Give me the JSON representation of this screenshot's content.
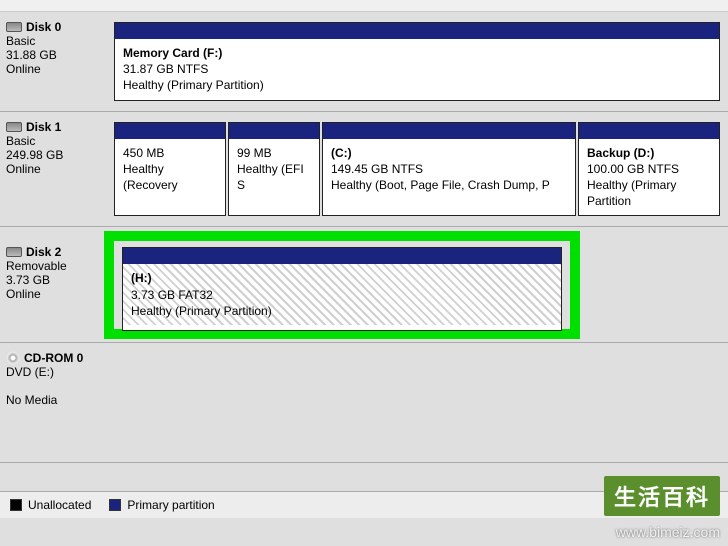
{
  "disks": [
    {
      "name": "Disk 0",
      "type": "Basic",
      "size": "31.88 GB",
      "status": "Online",
      "partitions": [
        {
          "label": "Memory Card  (F:)",
          "fs": "31.87 GB NTFS",
          "health": "Healthy (Primary Partition)"
        }
      ]
    },
    {
      "name": "Disk 1",
      "type": "Basic",
      "size": "249.98 GB",
      "status": "Online",
      "partitions": [
        {
          "label": "",
          "fs": "450 MB",
          "health": "Healthy (Recovery"
        },
        {
          "label": "",
          "fs": "99 MB",
          "health": "Healthy (EFI S"
        },
        {
          "label": " (C:)",
          "fs": "149.45 GB NTFS",
          "health": "Healthy (Boot, Page File, Crash Dump, P"
        },
        {
          "label": "Backup  (D:)",
          "fs": "100.00 GB NTFS",
          "health": "Healthy (Primary Partition"
        }
      ]
    },
    {
      "name": "Disk 2",
      "type": "Removable",
      "size": "3.73 GB",
      "status": "Online",
      "partitions": [
        {
          "label": " (H:)",
          "fs": "3.73 GB FAT32",
          "health": "Healthy (Primary Partition)"
        }
      ]
    },
    {
      "name": "CD-ROM 0",
      "type": "DVD (E:)",
      "size": "",
      "status": "No Media",
      "partitions": []
    }
  ],
  "legend": {
    "unallocated": "Unallocated",
    "primary": "Primary partition"
  },
  "watermark": {
    "badge": "生活百科",
    "url": "www.bimeiz.com"
  }
}
